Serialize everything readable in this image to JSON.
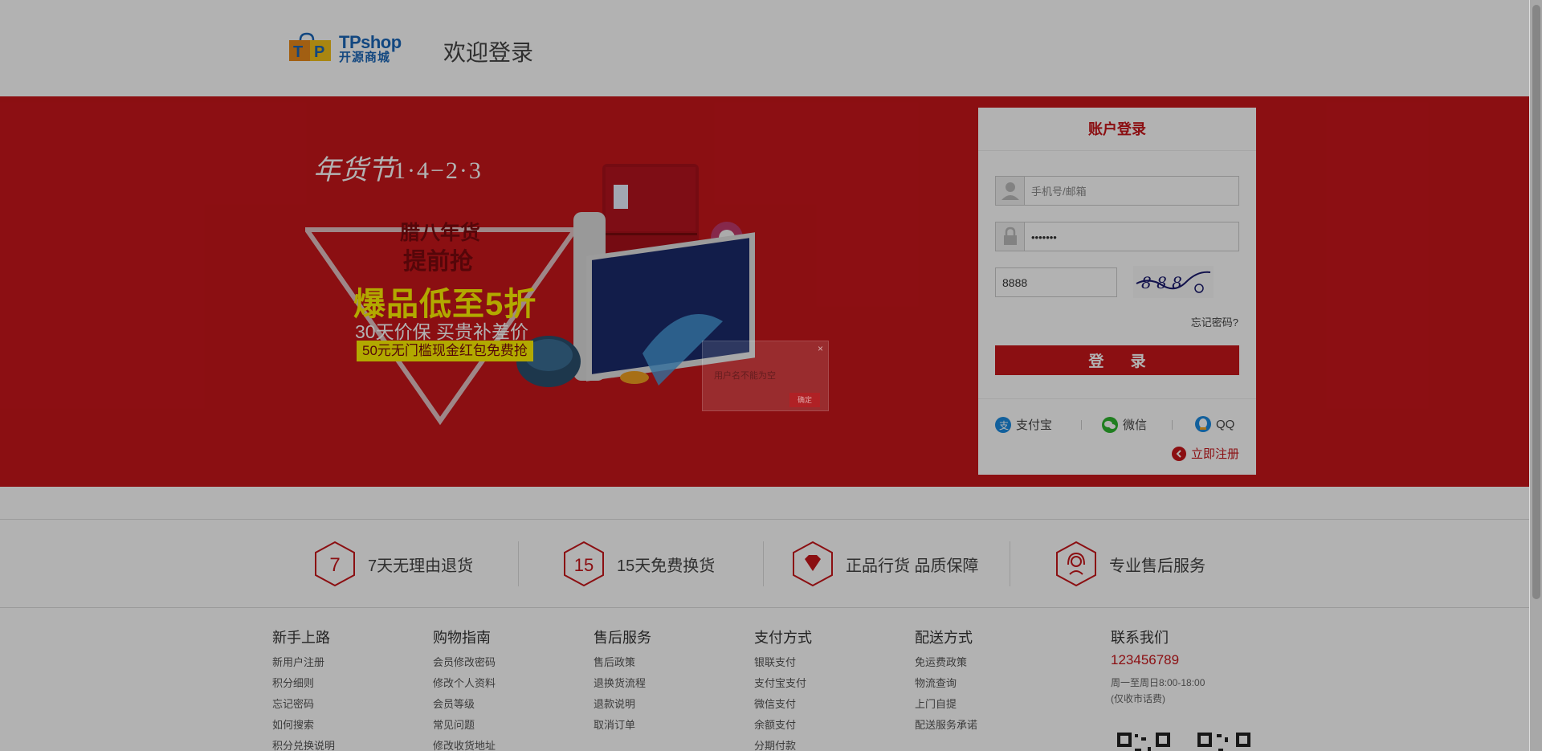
{
  "header": {
    "logo_en": "TPshop",
    "logo_cn": "开源商城",
    "welcome": "欢迎登录"
  },
  "banner": {
    "festival_logo": "年货节",
    "dates": "1·4−2·3",
    "line1": "腊八年货",
    "line2": "提前抢",
    "line3": "爆品低至5折",
    "line4": "30天价保  买贵补差价",
    "line5": "50元无门槛现金红包免费抢"
  },
  "login": {
    "title": "账户登录",
    "username_placeholder": "手机号/邮箱",
    "username_value": "",
    "password_value": "1234567",
    "captcha_value": "8888",
    "forgot": "忘记密码?",
    "submit": "登 录",
    "social": {
      "alipay": "支付宝",
      "wechat": "微信",
      "qq": "QQ"
    },
    "register": "立即注册"
  },
  "modal": {
    "close": "×",
    "message": "用户名不能为空",
    "confirm": "确定"
  },
  "services": [
    {
      "badge": "7",
      "label": "7天无理由退货"
    },
    {
      "badge": "15",
      "label": "15天免费换货"
    },
    {
      "badge": "diamond",
      "label": "正品行货 品质保障"
    },
    {
      "badge": "headset",
      "label": "专业售后服务"
    }
  ],
  "footer": {
    "columns": [
      {
        "title": "新手上路",
        "links": [
          "新用户注册",
          "积分细则",
          "忘记密码",
          "如何搜索",
          "积分兑换说明"
        ]
      },
      {
        "title": "购物指南",
        "links": [
          "会员修改密码",
          "修改个人资料",
          "会员等级",
          "常见问题",
          "修改收货地址"
        ]
      },
      {
        "title": "售后服务",
        "links": [
          "售后政策",
          "退换货流程",
          "退款说明",
          "取消订单"
        ]
      },
      {
        "title": "支付方式",
        "links": [
          "银联支付",
          "支付宝支付",
          "微信支付",
          "余额支付",
          "分期付款"
        ]
      },
      {
        "title": "配送方式",
        "links": [
          "免运费政策",
          "物流查询",
          "上门自提",
          "配送服务承诺"
        ]
      }
    ],
    "contact": {
      "title": "联系我们",
      "phone": "123456789",
      "hours_line1": "周一至周日8:00-18:00",
      "hours_line2": "(仅收市话费)"
    }
  },
  "colors": {
    "brand_red": "#c8161b",
    "logo_blue": "#1a66b8",
    "promo_yellow": "#fff200"
  }
}
